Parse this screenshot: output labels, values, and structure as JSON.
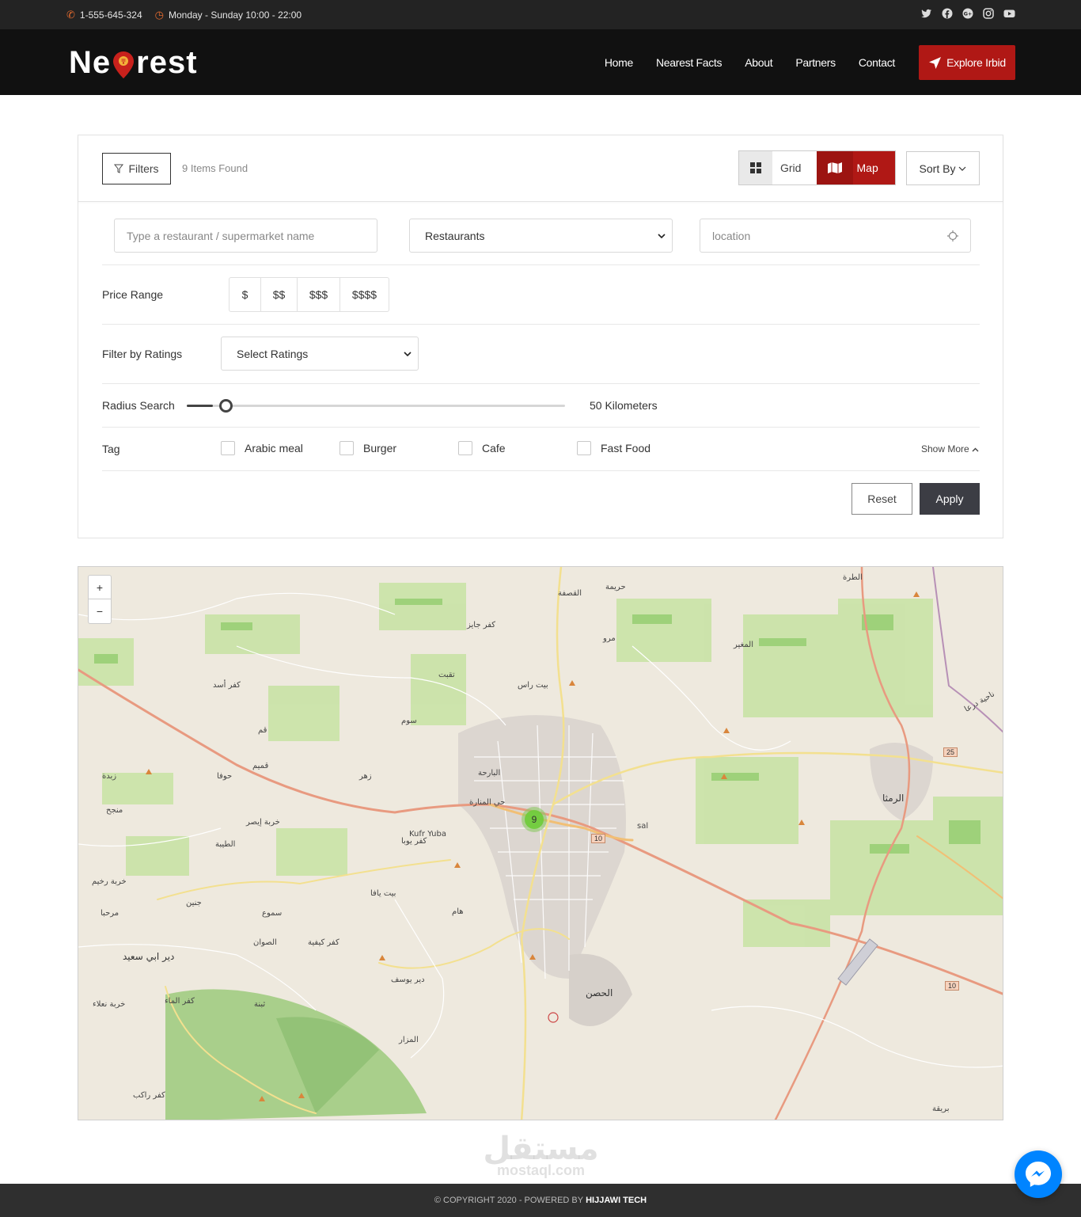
{
  "topbar": {
    "phone": "1-555-645-324",
    "hours": "Monday - Sunday 10:00 - 22:00",
    "social_icons": [
      "twitter-icon",
      "facebook-icon",
      "google-plus-icon",
      "instagram-icon",
      "youtube-icon"
    ]
  },
  "header": {
    "logo_left": "Ne",
    "logo_right": "rest",
    "nav": [
      "Home",
      "Nearest Facts",
      "About",
      "Partners",
      "Contact"
    ],
    "cta": "Explore Irbid"
  },
  "toolbar": {
    "filters_label": "Filters",
    "items_found": "9 Items Found",
    "grid_label": "Grid",
    "map_label": "Map",
    "sort_label": "Sort By"
  },
  "search": {
    "name_placeholder": "Type a restaurant / supermarket name",
    "category_selected": "Restaurants",
    "location_placeholder": "location"
  },
  "filters": {
    "price_label": "Price Range",
    "price_options": [
      "$",
      "$$",
      "$$$",
      "$$$$"
    ],
    "ratings_label": "Filter by Ratings",
    "ratings_selected": "Select Ratings",
    "radius_label": "Radius Search",
    "radius_text": "50 Kilometers",
    "radius_fraction": 0.07,
    "tag_label": "Tag",
    "tags": [
      "Arabic meal",
      "Burger",
      "Cafe",
      "Fast Food"
    ],
    "show_more": "Show More",
    "reset_label": "Reset",
    "apply_label": "Apply"
  },
  "map": {
    "zoom_in": "+",
    "zoom_out": "−",
    "cluster_count": "9",
    "places": [
      "الطرة",
      "حريمة",
      "القصفة",
      "كفر جايز",
      "مرو",
      "المغير",
      "بيت راس",
      "تقبت",
      "كفر أسد",
      "قم",
      "سوم",
      "قميم",
      "حوفا",
      "زهر",
      "زبدة",
      "البارحة",
      "حي المنارة",
      "الرمثا",
      "منجح",
      "خربة إيصر",
      "Kufr Yuba",
      "كفر يوبا",
      "sal",
      "الطيبة",
      "خربة رخيم",
      "جنين",
      "بيت يافا",
      "مرحبا",
      "سموع",
      "هام",
      "الصوان",
      "كفر كيفية",
      "دير ابي سعيد",
      "دير يوسف",
      "الحصن",
      "كفر الماء",
      "خربة نعلاء",
      "ثبنة",
      "المزار",
      "كفر راكب",
      "بريقة",
      "ناحية درعا"
    ],
    "road_numbers": [
      "10",
      "25",
      "10"
    ]
  },
  "footer": {
    "copyright": "© COPYRIGHT 2020 - POWERED BY",
    "company": "HIJJAWI TECH"
  },
  "watermark": {
    "arabic": "مستقل",
    "latin": "mostaql.com"
  },
  "colors": {
    "brand_red": "#b01815",
    "dark": "#111111",
    "apply_button": "#3c3d44"
  }
}
